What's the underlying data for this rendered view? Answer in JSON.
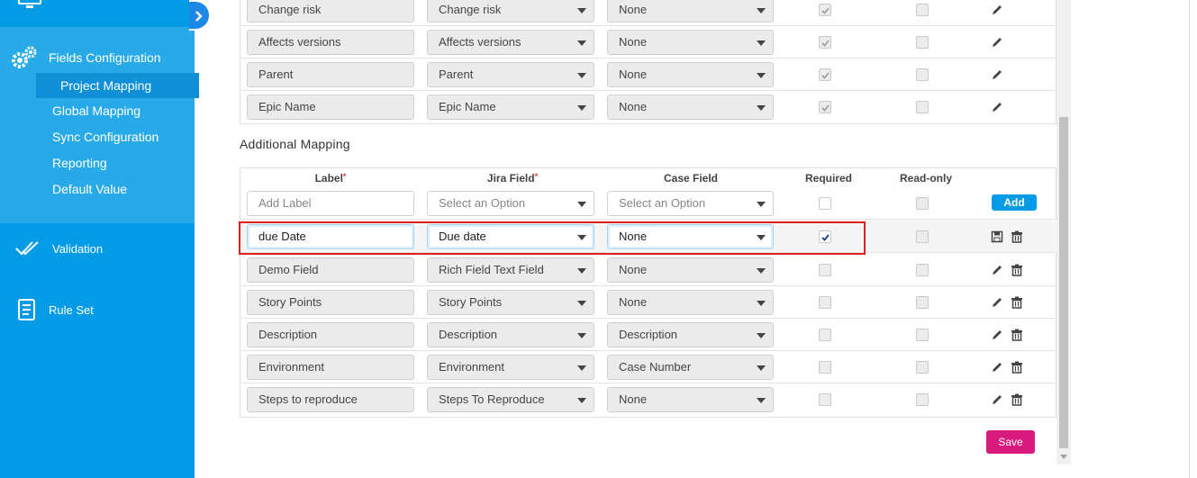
{
  "sidebar": {
    "fields_configuration": "Fields Configuration",
    "sub_items": [
      "Project Mapping",
      "Global Mapping",
      "Sync Configuration",
      "Reporting",
      "Default Value"
    ],
    "validation": "Validation",
    "rule_set": "Rule Set"
  },
  "upper_rows": [
    {
      "label": "Change risk",
      "jira": "Change risk",
      "case": "None",
      "required": true,
      "readonly": false
    },
    {
      "label": "Affects versions",
      "jira": "Affects versions",
      "case": "None",
      "required": true,
      "readonly": false
    },
    {
      "label": "Parent",
      "jira": "Parent",
      "case": "None",
      "required": true,
      "readonly": false
    },
    {
      "label": "Epic Name",
      "jira": "Epic Name",
      "case": "None",
      "required": true,
      "readonly": false
    }
  ],
  "additional": {
    "title": "Additional Mapping",
    "headers": {
      "label": "Label",
      "jira": "Jira Field",
      "case": "Case Field",
      "required": "Required",
      "readonly": "Read-only"
    },
    "new_row": {
      "label_placeholder": "Add Label",
      "jira_placeholder": "Select an Option",
      "case_placeholder": "Select an Option",
      "add": "Add"
    },
    "editing_row": {
      "label": "due Date",
      "jira": "Due date",
      "case": "None",
      "required": true,
      "readonly": false
    },
    "rows": [
      {
        "label": "Demo Field",
        "jira": "Rich Field Text Field",
        "case": "None"
      },
      {
        "label": "Story Points",
        "jira": "Story Points",
        "case": "None"
      },
      {
        "label": "Description",
        "jira": "Description",
        "case": "Description"
      },
      {
        "label": "Environment",
        "jira": "Environment",
        "case": "Case Number"
      },
      {
        "label": "Steps to reproduce",
        "jira": "Steps To Reproduce",
        "case": "None"
      }
    ]
  },
  "save_label": "Save",
  "colors": {
    "sidebar": "#039be5",
    "sidebar_section": "#29aae8",
    "accent": "#039be5",
    "save": "#d81b7c",
    "highlight": "#e02020"
  }
}
